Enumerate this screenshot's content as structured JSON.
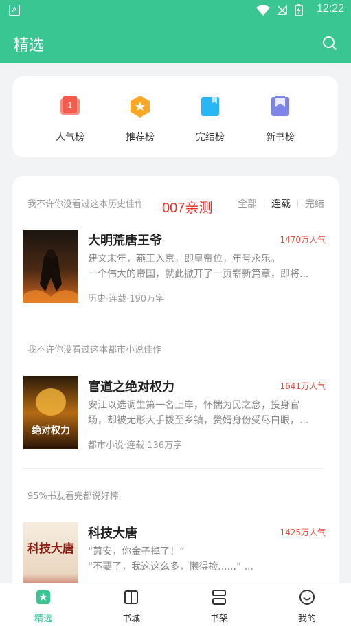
{
  "status_bar": {
    "time": "12:22",
    "app_badge": "A"
  },
  "header": {
    "title": "精选"
  },
  "categories": [
    {
      "label": "人气榜",
      "icon": "popularity-rank-icon",
      "badge": "1"
    },
    {
      "label": "推荐榜",
      "icon": "recommend-rank-icon"
    },
    {
      "label": "完结榜",
      "icon": "finished-rank-icon"
    },
    {
      "label": "新书榜",
      "icon": "new-book-rank-icon"
    }
  ],
  "feed": {
    "watermark": "007亲测",
    "filters": [
      "全部",
      "连载",
      "完结"
    ],
    "active_filter": "连载",
    "sections": [
      {
        "heading": "我不许你没看过这本历史佳作",
        "book": {
          "title": "大明荒唐王爷",
          "popularity": "1470万人气",
          "desc": [
            "建文末年，燕王入京，即皇帝位，年号永乐。",
            "一个伟大的帝国，就此掀开了一页崭新篇章，即将..."
          ],
          "meta": "历史·连载·190万字"
        }
      },
      {
        "heading": "我不许你没看过这本都市小说佳作",
        "book": {
          "title": "官道之绝对权力",
          "popularity": "1641万人气",
          "desc": [
            "安江以选调生第一名上岸，怀揣为民之念，投身官",
            "场，却被无形大手拨至乡镇，赘婿身份受尽白眼，..."
          ],
          "meta": "都市小说·连载·136万字",
          "cover_text": "绝对权力"
        }
      },
      {
        "heading": "95%书友看完都说好棒",
        "book": {
          "title": "科技大唐",
          "popularity": "1425万人气",
          "desc": [
            "“萧安，你金子掉了！”",
            "“不要了，我这这么多，懒得捡......” ..."
          ],
          "meta": "",
          "cover_text": "科技大唐"
        }
      }
    ]
  },
  "tabs": [
    {
      "label": "精选",
      "icon": "featured-icon",
      "active": true
    },
    {
      "label": "书城",
      "icon": "book-city-icon"
    },
    {
      "label": "书架",
      "icon": "bookshelf-icon"
    },
    {
      "label": "我的",
      "icon": "profile-icon"
    }
  ],
  "colors": {
    "brand": "#39c693",
    "popularity": "#e24a3b",
    "watermark": "#e52d27"
  }
}
